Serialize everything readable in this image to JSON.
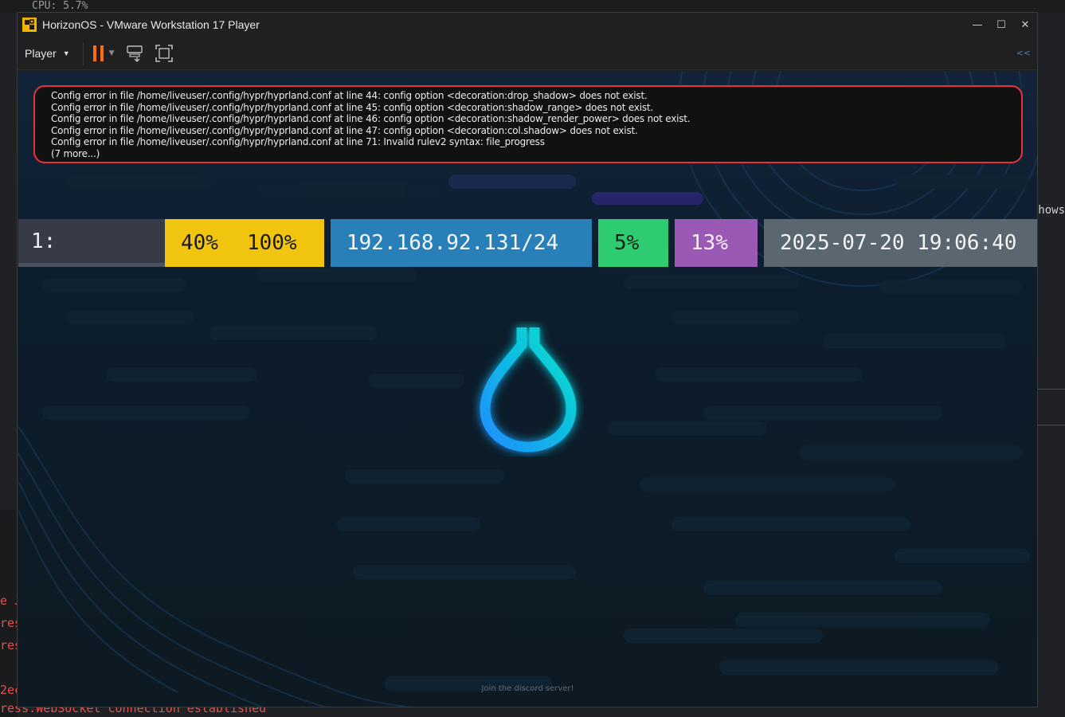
{
  "background": {
    "top_line": "CPU: 5.7%",
    "right_text": "hows",
    "terminal_lines": [
      "e J",
      "res",
      "res",
      "",
      "2ec"
    ],
    "terminal_bottom": "ress.WebSocket connection established"
  },
  "window": {
    "title": "HorizonOS - VMware Workstation 17 Player",
    "minimize": "—",
    "maximize": "☐",
    "close": "✕"
  },
  "toolbar": {
    "player_label": "Player",
    "right_indicator": "<<"
  },
  "errors": {
    "lines": [
      "Config error in file /home/liveuser/.config/hypr/hyprland.conf at line 44: config option <decoration:drop_shadow> does not exist.",
      "Config error in file /home/liveuser/.config/hypr/hyprland.conf at line 45: config option <decoration:shadow_range> does not exist.",
      "Config error in file /home/liveuser/.config/hypr/hyprland.conf at line 46: config option <decoration:shadow_render_power> does not exist.",
      "Config error in file /home/liveuser/.config/hypr/hyprland.conf at line 47: config option <decoration:col.shadow> does not exist.",
      "Config error in file /home/liveuser/.config/hypr/hyprland.conf at line 71: Invalid rulev2 syntax:  file_progress",
      "(7 more...)"
    ],
    "border_color": "#e5323b"
  },
  "waybar": {
    "workspace": "1:",
    "yellow_left": "40%",
    "yellow_right": "100%",
    "network": "192.168.92.131/24",
    "cpu": "5%",
    "memory": "13%",
    "clock": "2025-07-20 19:06:40",
    "colors": {
      "workspace": "#363b45",
      "yellow": "#f1c40f",
      "network": "#2980b9",
      "cpu": "#2ecc71",
      "memory": "#9b59b6",
      "clock": "#5a6670"
    }
  },
  "logo": {
    "icon": "water-drop-icon",
    "gradient": [
      "#00e5c8",
      "#1e90ff"
    ]
  },
  "footer": {
    "discord_text": "Join the discord server!"
  }
}
